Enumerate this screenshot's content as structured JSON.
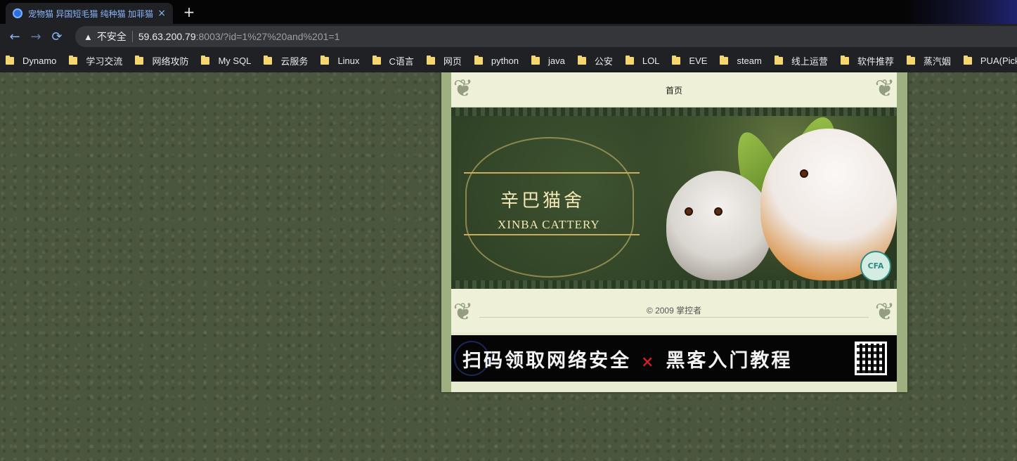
{
  "browser": {
    "tab_title": "宠物猫 异国短毛猫 纯种猫 加菲猫",
    "tab_close": "×",
    "new_tab": "+",
    "security_label": "不安全",
    "url_host": "59.63.200.79",
    "url_path": ":8003/?id=1%27%20and%201=1",
    "nav": {
      "back": "←",
      "forward": "→",
      "reload": "⟳",
      "warn": "▲"
    }
  },
  "bookmarks": [
    "Dynamo",
    "学习交流",
    "网络攻防",
    "My SQL",
    "云服务",
    "Linux",
    "C语言",
    "网页",
    "python",
    "java",
    "公安",
    "LOL",
    "EVE",
    "steam",
    "线上运营",
    "软件推荐",
    "蒸汽姻",
    "PUA(Pick-up Artist)"
  ],
  "site": {
    "nav_home": "首页",
    "logo_cn": "辛巴猫舍",
    "logo_en": "XINBA CATTERY",
    "seal_text": "CFA",
    "copyright": "© 2009 掌控者",
    "ad": {
      "left_text": "扫码领取网络安全",
      "cross": "×",
      "right_text": "黑客入门教程"
    }
  },
  "colors": {
    "page_background": "#4b563e",
    "tab_text": "#8ab4f8",
    "bookmark_folder": "#f6d66e",
    "ad_cross": "#d42020"
  },
  "icons": [
    "globe-icon",
    "close-icon",
    "plus-icon",
    "back-arrow-icon",
    "forward-arrow-icon",
    "reload-icon",
    "warning-icon",
    "folder-icon",
    "qr-code-icon"
  ]
}
